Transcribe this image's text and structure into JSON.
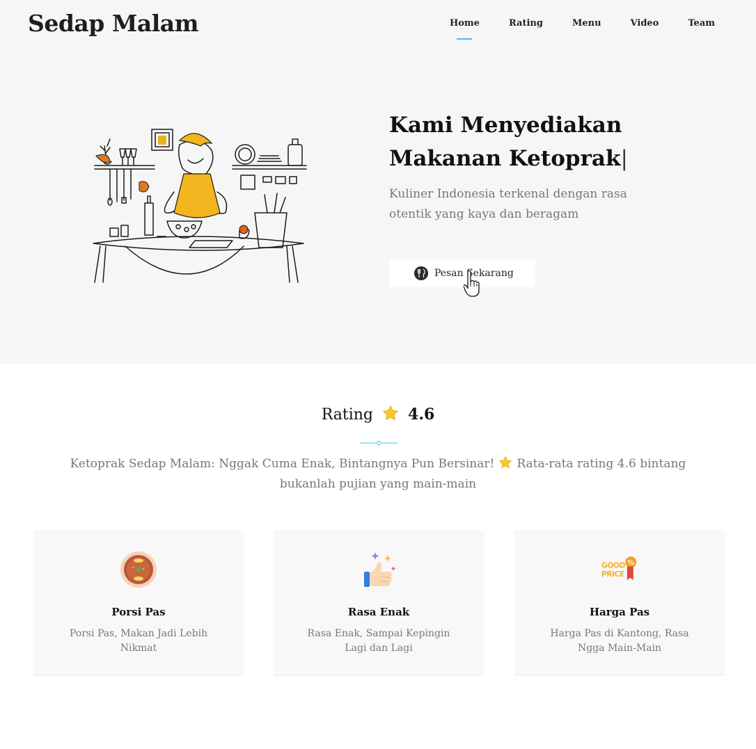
{
  "brand": "Sedap Malam",
  "nav": [
    {
      "label": "Home",
      "active": true
    },
    {
      "label": "Rating"
    },
    {
      "label": "Menu"
    },
    {
      "label": "Video"
    },
    {
      "label": "Team"
    }
  ],
  "hero": {
    "title_line1": "Kami Menyediakan",
    "title_line2": "Makanan Ketoprak",
    "caret": "|",
    "subtitle": "Kuliner Indonesia terkenal dengan rasa otentik yang kaya dan beragam",
    "cta_label": "Pesan Sekarang",
    "cta_icon": "utensils-icon"
  },
  "rating": {
    "heading": "Rating",
    "value": "4.6",
    "desc_part1": "Ketoprak Sedap Malam: Nggak Cuma Enak, Bintangnya Pun Bersinar!",
    "desc_part2": "Rata-rata rating 4.6 bintang bukanlah pujian yang main-main"
  },
  "cards": [
    {
      "title": "Porsi Pas",
      "desc": "Porsi Pas, Makan Jadi Lebih Nikmat",
      "icon": "bowl-icon"
    },
    {
      "title": "Rasa Enak",
      "desc": "Rasa Enak, Sampai Kepingin Lagi dan Lagi",
      "icon": "thumbs-up-icon"
    },
    {
      "title": "Harga Pas",
      "desc": "Harga Pas di Kantong, Rasa Ngga Main-Main",
      "icon": "good-price-icon",
      "badge_line1": "GOOD",
      "badge_line2": "PRICE",
      "badge_mark": "%"
    }
  ],
  "colors": {
    "accent": "#3ac4e6",
    "star": "#f8c92c",
    "apron": "#f2b51f",
    "hero_bg": "#f6f6f6"
  }
}
